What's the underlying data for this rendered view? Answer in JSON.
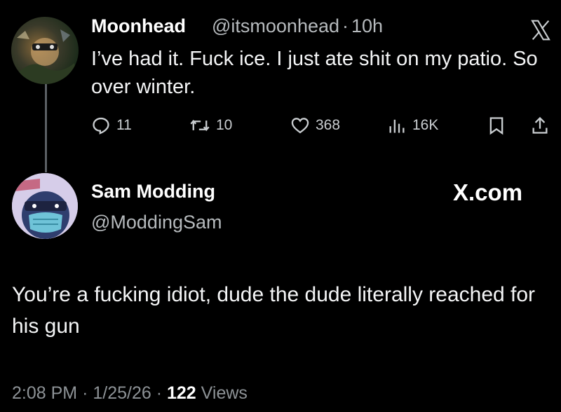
{
  "colors": {
    "background": "#000000",
    "primary_text": "#e7e9ea",
    "secondary_text": "#8d9296",
    "thread_line": "#5b6064"
  },
  "original_tweet": {
    "display_name": "Moonhead",
    "handle": "@itsmoonhead",
    "separator": "·",
    "time_ago": "10h",
    "text": "I’ve had it. Fuck ice. I just ate shit on my patio. So over winter.",
    "avatar_icon": "user-avatar-moonhead",
    "platform_icon": "x-logo-icon",
    "actions": {
      "replies": "11",
      "retweets": "10",
      "likes": "368",
      "views": "16K",
      "reply_icon": "reply-icon",
      "retweet_icon": "retweet-icon",
      "like_icon": "heart-icon",
      "views_icon": "analytics-icon",
      "bookmark_icon": "bookmark-icon",
      "share_icon": "share-icon"
    }
  },
  "reply_tweet": {
    "display_name": "Sam Modding",
    "handle": "@ModdingSam",
    "platform_label": "X.com",
    "avatar_icon": "user-avatar-sam",
    "text": "You’re a fucking idiot, dude the dude literally reached for his gun",
    "footer": {
      "time": "2:08 PM",
      "separator": "·",
      "date": "1/25/26",
      "views_count": "122",
      "views_label": "Views"
    }
  }
}
